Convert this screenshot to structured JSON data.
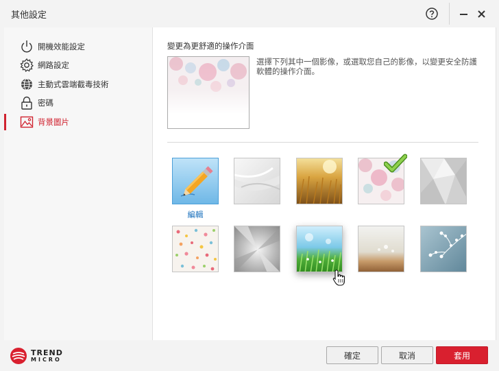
{
  "window": {
    "title": "其他設定"
  },
  "sidebar": {
    "items": [
      {
        "label": "開機效能設定",
        "icon": "power-icon"
      },
      {
        "label": "網路設定",
        "icon": "gear-icon"
      },
      {
        "label": "主動式雲端截毒技術",
        "icon": "globe-icon"
      },
      {
        "label": "密碼",
        "icon": "lock-icon"
      },
      {
        "label": "背景圖片",
        "icon": "picture-icon",
        "active": true
      }
    ]
  },
  "main": {
    "section_title": "變更為更舒適的操作介面",
    "description": "選擇下列其中一個影像，或選取您自己的影像，以變更安全防護軟體的操作介面。",
    "edit_label": "編輯"
  },
  "footer": {
    "logo_line1": "TREND",
    "logo_line2": "MICRO",
    "ok_label": "確定",
    "cancel_label": "取消",
    "apply_label": "套用"
  },
  "colors": {
    "accent": "#d9202f",
    "link": "#1e73be"
  }
}
